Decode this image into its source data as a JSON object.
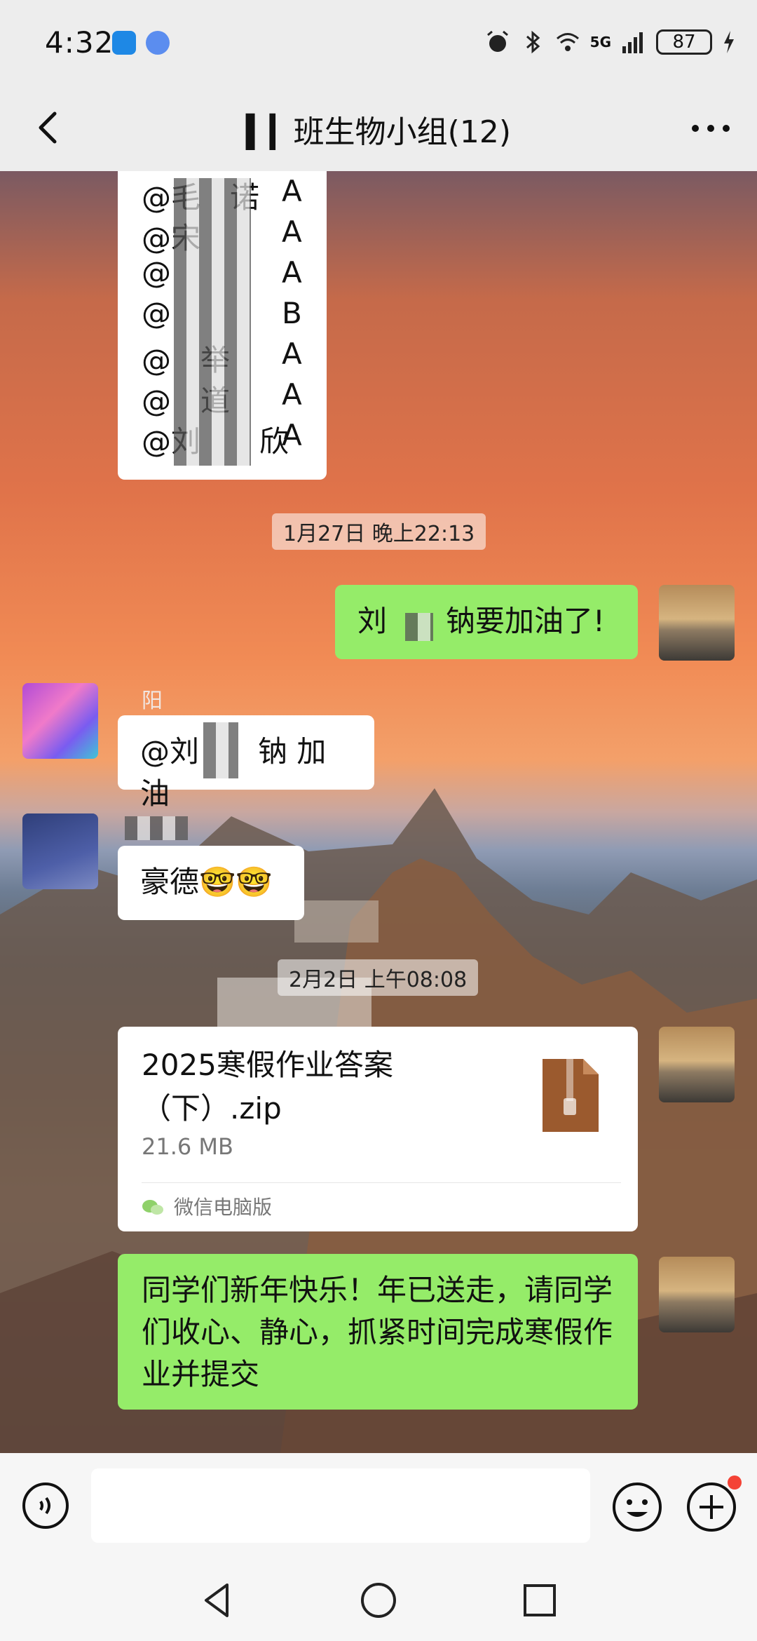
{
  "status": {
    "time": "4:32",
    "battery": "87",
    "network": "5G"
  },
  "header": {
    "title": "▍▎班生物小组(12)",
    "back_icon": "chevron-left-icon",
    "more_icon": "more-dots-icon"
  },
  "mentions": [
    {
      "name": "@毛 诺",
      "grade": "A"
    },
    {
      "name": "@宋",
      "grade": "A"
    },
    {
      "name": "@",
      "grade": "A"
    },
    {
      "name": "@",
      "grade": "B"
    },
    {
      "name": "@ 举",
      "grade": "A"
    },
    {
      "name": "@ 道",
      "grade": "A"
    },
    {
      "name": "@刘  欣",
      "grade": "A"
    }
  ],
  "messages": {
    "ts1": "1月27日 晚上22:13",
    "msg1": "刘  钠要加油了!",
    "sender2": " 阳",
    "msg2": "@刘  钠  加油",
    "msg3": "豪德🤓🤓",
    "ts2": "2月2日 上午08:08",
    "file": {
      "name": "2025寒假作业答案（下）.zip",
      "size": "21.6 MB",
      "source": "微信电脑版",
      "icon": "zip-file-icon"
    },
    "msg4": "同学们新年快乐！年已送走，请同学们收心、静心，抓紧时间完成寒假作业并提交"
  },
  "input": {
    "placeholder": ""
  },
  "colors": {
    "self_bubble": "#95ec69",
    "other_bubble": "#ffffff",
    "bar_bg": "#ededed"
  }
}
